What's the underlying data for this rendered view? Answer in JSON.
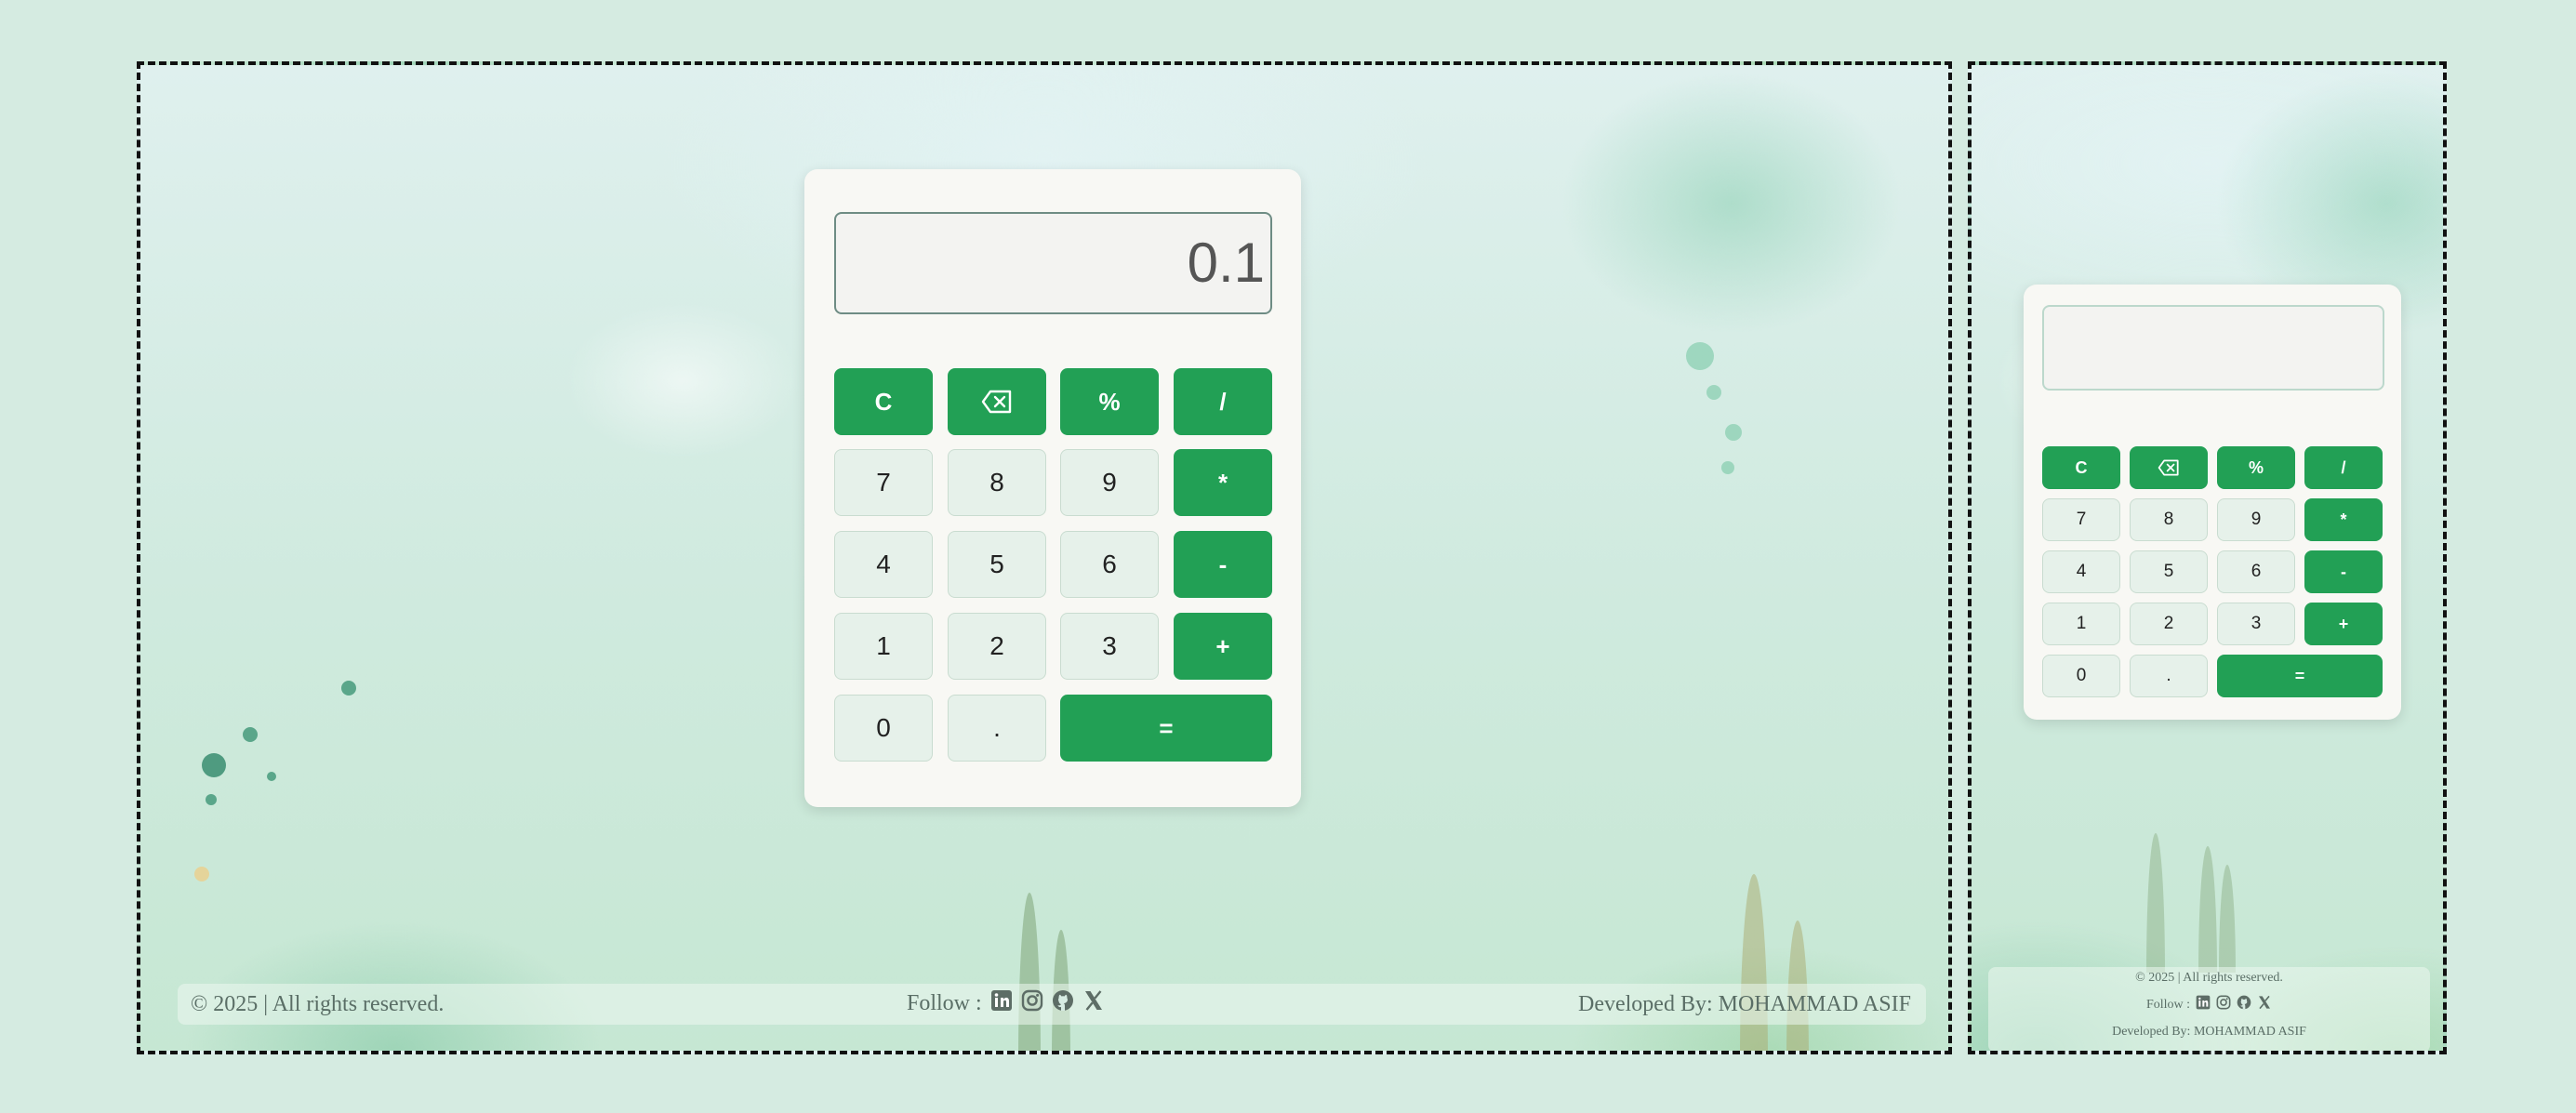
{
  "calculator": {
    "display_value": "0.1",
    "narrow_display_value": "",
    "buttons": {
      "clear": "C",
      "percent": "%",
      "divide": "/",
      "seven": "7",
      "eight": "8",
      "nine": "9",
      "multiply": "*",
      "four": "4",
      "five": "5",
      "six": "6",
      "subtract": "-",
      "one": "1",
      "two": "2",
      "three": "3",
      "add": "+",
      "zero": "0",
      "decimal": ".",
      "equals": "="
    },
    "icons": {
      "backspace": "backspace-icon"
    }
  },
  "footer": {
    "copyright": "© 2025 | All rights reserved.",
    "follow_label": "Follow :",
    "social_icons": [
      "linkedin-icon",
      "instagram-icon",
      "github-icon",
      "x-icon"
    ],
    "developer": "Developed By: MOHAMMAD ASIF"
  },
  "colors": {
    "accent": "#22a055",
    "key_background": "#e6f1ea",
    "page_background": "#d5ebe1",
    "panel_background": "#f8f8f4"
  }
}
